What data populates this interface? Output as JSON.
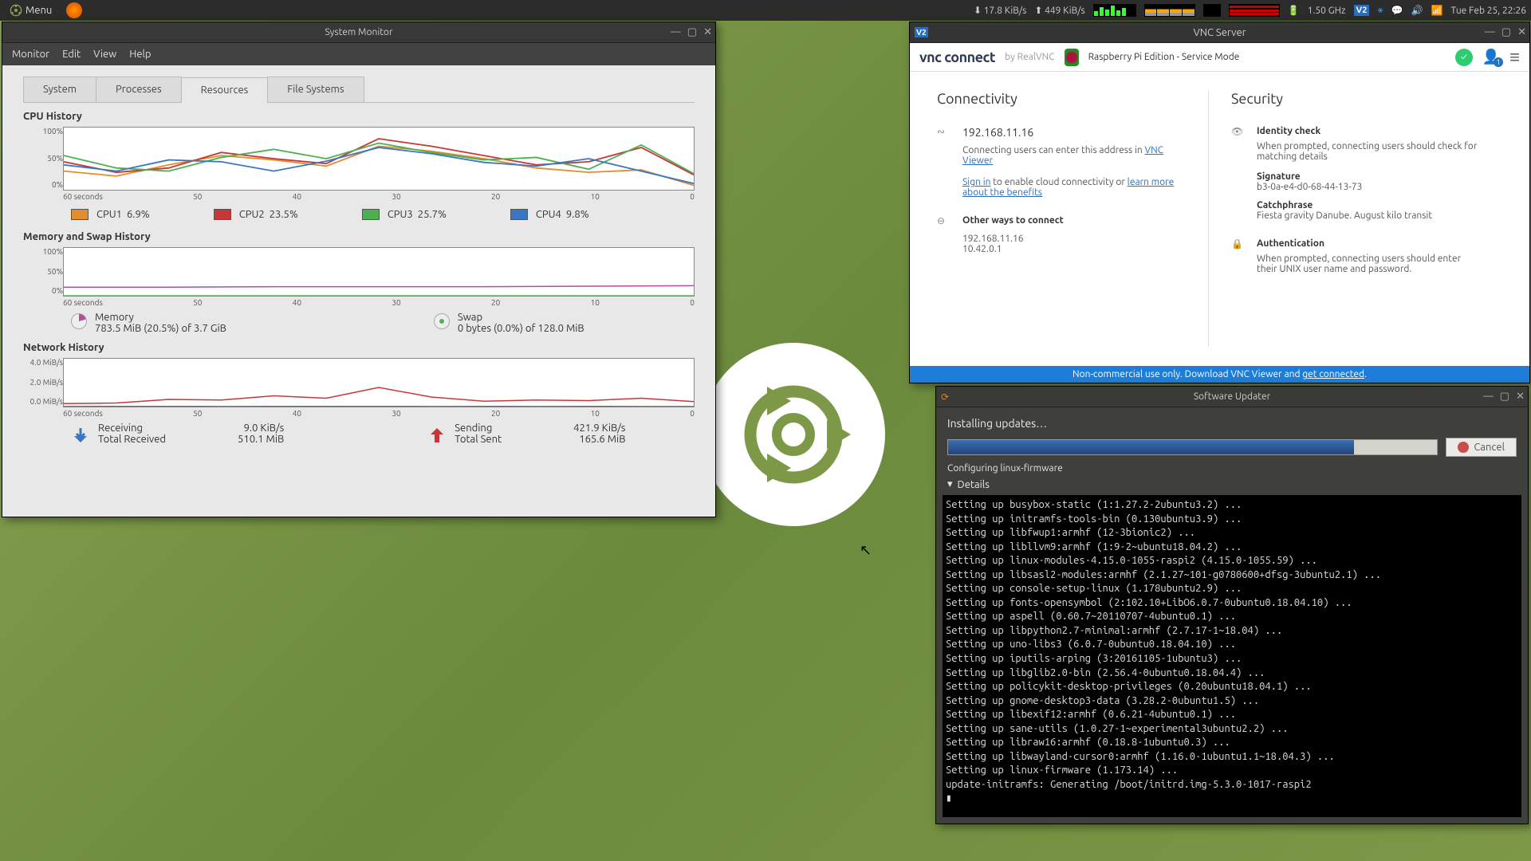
{
  "panel": {
    "menu_label": "Menu",
    "net_down": "17.8 KiB/s",
    "net_up": "449 KiB/s",
    "freq": "1.50 GHz",
    "clock": "Tue Feb 25, 22:26"
  },
  "system_monitor": {
    "title": "System Monitor",
    "menus": [
      "Monitor",
      "Edit",
      "View",
      "Help"
    ],
    "tabs": [
      "System",
      "Processes",
      "Resources",
      "File Systems"
    ],
    "active_tab": "Resources",
    "cpu_title": "CPU History",
    "cpu_ylabels": [
      "100%",
      "50%",
      "0%"
    ],
    "x_labels": [
      "60 seconds",
      "50",
      "40",
      "30",
      "20",
      "10",
      "0"
    ],
    "cpus": [
      {
        "label": "CPU1",
        "pct": "6.9%",
        "color": "#e38d2c"
      },
      {
        "label": "CPU2",
        "pct": "23.5%",
        "color": "#c83737"
      },
      {
        "label": "CPU3",
        "pct": "25.7%",
        "color": "#4caf50"
      },
      {
        "label": "CPU4",
        "pct": "9.8%",
        "color": "#3a77c2"
      }
    ],
    "mem_title": "Memory and Swap History",
    "mem_ylabels": [
      "100%",
      "50%",
      "0%"
    ],
    "memory_label": "Memory",
    "memory_detail": "783.5 MiB (20.5%) of 3.7 GiB",
    "swap_label": "Swap",
    "swap_detail": "0 bytes (0.0%) of 128.0 MiB",
    "net_title": "Network History",
    "net_ylabels": [
      "4.0 MiB/s",
      "2.0 MiB/s",
      "0.0 MiB/s"
    ],
    "receiving_label": "Receiving",
    "receiving_rate": "9.0 KiB/s",
    "total_recv_label": "Total Received",
    "total_recv": "510.1 MiB",
    "sending_label": "Sending",
    "sending_rate": "421.9 KiB/s",
    "total_sent_label": "Total Sent",
    "total_sent": "165.6 MiB"
  },
  "vnc": {
    "title": "VNC Server",
    "brand_by": "by RealVNC",
    "mode": "Raspberry Pi Edition - Service Mode",
    "h_connectivity": "Connectivity",
    "ip": "192.168.11.16",
    "ip_help_1": "Connecting users can enter this address in ",
    "ip_help_link": "VNC Viewer",
    "signin_link": "Sign in",
    "signin_text": " to enable cloud connectivity or ",
    "learn_link": "learn more about the benefits",
    "other_ways": "Other ways to connect",
    "other_ips": [
      "192.168.11.16",
      "10.42.0.1"
    ],
    "h_security": "Security",
    "identity": "Identity check",
    "identity_help": "When prompted, connecting users should check for matching details",
    "signature_label": "Signature",
    "signature": "b3-0a-e4-d0-68-44-13-73",
    "catch_label": "Catchphrase",
    "catchphrase": "Fiesta gravity Danube. August kilo transit",
    "auth": "Authentication",
    "auth_help": "When prompted, connecting users should enter their UNIX user name and password.",
    "footer_a": "Non-commercial use only. Download VNC Viewer and ",
    "footer_link": "get connected"
  },
  "updater": {
    "title": "Software Updater",
    "heading": "Installing updates…",
    "cancel": "Cancel",
    "status": "Configuring linux-firmware",
    "details": "Details",
    "terminal_lines": [
      "Setting up busybox-static (1:1.27.2-2ubuntu3.2) ...",
      "Setting up initramfs-tools-bin (0.130ubuntu3.9) ...",
      "Setting up libfwup1:armhf (12-3bionic2) ...",
      "Setting up libllvm9:armhf (1:9-2~ubuntu18.04.2) ...",
      "Setting up linux-modules-4.15.0-1055-raspi2 (4.15.0-1055.59) ...",
      "Setting up libsasl2-modules:armhf (2.1.27~101-g0780600+dfsg-3ubuntu2.1) ...",
      "Setting up console-setup-linux (1.178ubuntu2.9) ...",
      "Setting up fonts-opensymbol (2:102.10+LibO6.0.7-0ubuntu0.18.04.10) ...",
      "Setting up aspell (0.60.7~20110707-4ubuntu0.1) ...",
      "Setting up libpython2.7-minimal:armhf (2.7.17-1~18.04) ...",
      "Setting up uno-libs3 (6.0.7-0ubuntu0.18.04.10) ...",
      "Setting up iputils-arping (3:20161105-1ubuntu3) ...",
      "Setting up libglib2.0-bin (2.56.4-0ubuntu0.18.04.4) ...",
      "Setting up policykit-desktop-privileges (0.20ubuntu18.04.1) ...",
      "Setting up gnome-desktop3-data (3.28.2-0ubuntu1.5) ...",
      "Setting up libexif12:armhf (0.6.21-4ubuntu0.1) ...",
      "Setting up sane-utils (1.0.27-1~experimental3ubuntu2.2) ...",
      "Setting up libraw16:armhf (0.18.8-1ubuntu0.3) ...",
      "Setting up libwayland-cursor0:armhf (1.16.0-1ubuntu1.1~18.04.3) ...",
      "Setting up linux-firmware (1.173.14) ...",
      "update-initramfs: Generating /boot/initrd.img-5.3.0-1017-raspi2",
      "▮"
    ]
  },
  "chart_data": [
    {
      "type": "line",
      "title": "CPU History",
      "xlabel": "seconds ago",
      "ylabel": "%",
      "ylim": [
        0,
        100
      ],
      "x": [
        60,
        55,
        50,
        45,
        40,
        35,
        30,
        25,
        20,
        15,
        10,
        5,
        0
      ],
      "series": [
        {
          "name": "CPU1",
          "color": "#e38d2c",
          "values": [
            30,
            22,
            40,
            55,
            48,
            38,
            70,
            62,
            50,
            35,
            28,
            32,
            7
          ]
        },
        {
          "name": "CPU2",
          "color": "#c83737",
          "values": [
            45,
            28,
            35,
            60,
            50,
            42,
            82,
            70,
            55,
            40,
            45,
            68,
            24
          ]
        },
        {
          "name": "CPU3",
          "color": "#4caf50",
          "values": [
            55,
            35,
            30,
            52,
            65,
            50,
            75,
            60,
            48,
            52,
            33,
            72,
            26
          ]
        },
        {
          "name": "CPU4",
          "color": "#3a77c2",
          "values": [
            40,
            30,
            48,
            45,
            30,
            46,
            68,
            58,
            44,
            38,
            50,
            30,
            10
          ]
        }
      ]
    },
    {
      "type": "line",
      "title": "Memory and Swap History",
      "xlabel": "seconds ago",
      "ylabel": "%",
      "ylim": [
        0,
        100
      ],
      "x": [
        60,
        50,
        40,
        30,
        20,
        10,
        0
      ],
      "series": [
        {
          "name": "Memory",
          "color": "#b14f9a",
          "values": [
            18,
            18,
            19,
            19,
            19,
            20,
            21
          ]
        },
        {
          "name": "Swap",
          "color": "#56b05b",
          "values": [
            0,
            0,
            0,
            0,
            0,
            0,
            0
          ]
        }
      ]
    },
    {
      "type": "line",
      "title": "Network History",
      "xlabel": "seconds ago",
      "ylabel": "MiB/s",
      "ylim": [
        0,
        4
      ],
      "x": [
        60,
        55,
        50,
        45,
        40,
        35,
        30,
        25,
        20,
        15,
        10,
        5,
        0
      ],
      "series": [
        {
          "name": "Receiving",
          "color": "#3a77c2",
          "values": [
            0.01,
            0.02,
            0.02,
            0.01,
            0.02,
            0.02,
            0.02,
            0.01,
            0.02,
            0.01,
            0.02,
            0.01,
            0.009
          ]
        },
        {
          "name": "Sending",
          "color": "#c83737",
          "values": [
            0.25,
            0.3,
            0.6,
            0.55,
            0.9,
            0.7,
            1.6,
            0.8,
            0.45,
            0.55,
            0.5,
            0.7,
            0.42
          ]
        }
      ]
    }
  ]
}
